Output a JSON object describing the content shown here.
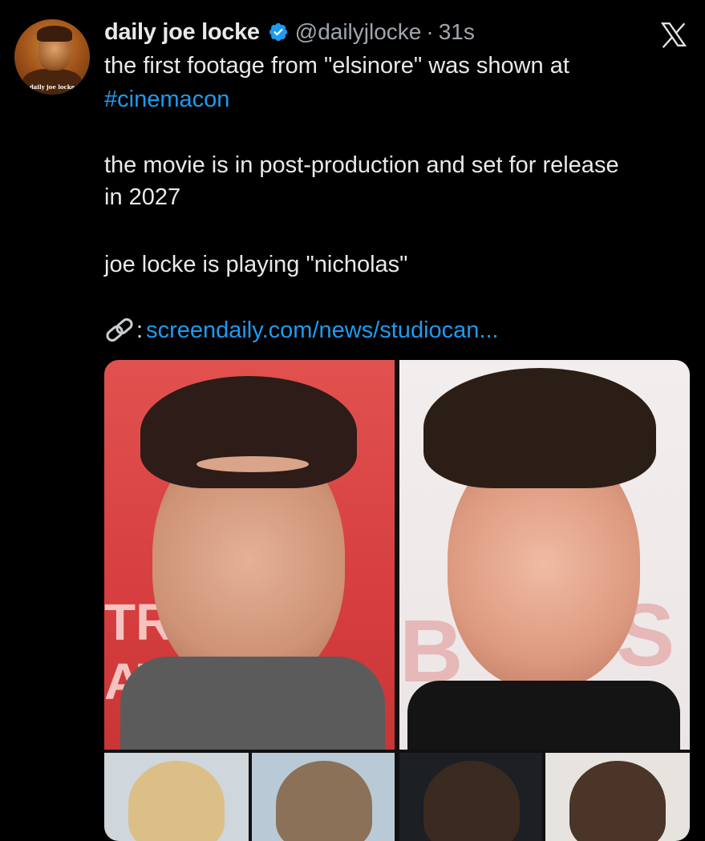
{
  "tweet": {
    "avatar_caption": "daily joe locke",
    "display_name": "daily joe locke",
    "handle": "@dailyjlocke",
    "separator": "·",
    "timestamp": "31s",
    "line1": "the first footage from \"elsinore\" was shown at",
    "hashtag": "#cinemacon",
    "line3": "the movie is in post-production and set for release",
    "line4": "in 2027",
    "line5": "joe locke is playing \"nicholas\"",
    "link_prefix": ":",
    "link_url": "screendaily.com/news/studiocan..."
  },
  "colors": {
    "background": "#000000",
    "text": "#e7e9ea",
    "secondary": "#a0a6ad",
    "link": "#1d9bf0",
    "verified": "#1d9bf0"
  },
  "icons": [
    "verified-badge-icon",
    "x-logo-icon",
    "link-icon"
  ]
}
